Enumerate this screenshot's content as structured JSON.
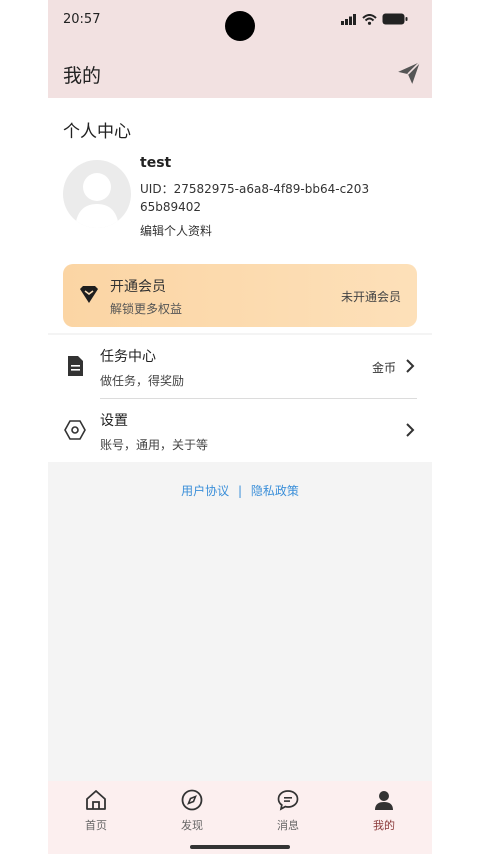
{
  "status_bar": {
    "time": "20:57"
  },
  "header": {
    "title": "我的"
  },
  "profile": {
    "section_title": "个人中心",
    "username": "test",
    "uid": "UID：27582975-a6a8-4f89-bb64-c20365b89402",
    "edit_label": "编辑个人资料"
  },
  "vip": {
    "title": "开通会员",
    "subtitle": "解锁更多权益",
    "status": "未开通会员"
  },
  "menu": [
    {
      "title": "任务中心",
      "subtitle": "做任务，得奖励",
      "right": "金币"
    },
    {
      "title": "设置",
      "subtitle": "账号，通用，关于等",
      "right": ""
    }
  ],
  "links": {
    "user_agreement": "用户协议",
    "separator": "|",
    "privacy": "隐私政策"
  },
  "tabs": [
    {
      "label": "首页",
      "icon": "home-icon"
    },
    {
      "label": "发现",
      "icon": "compass-icon"
    },
    {
      "label": "消息",
      "icon": "message-icon"
    },
    {
      "label": "我的",
      "icon": "user-icon",
      "active": true
    }
  ],
  "colors": {
    "header_bg": "#f2e1e1",
    "vip_gradient": "#fbd5a4",
    "link": "#3b8fd9",
    "tab_active": "#8a3a3a"
  }
}
